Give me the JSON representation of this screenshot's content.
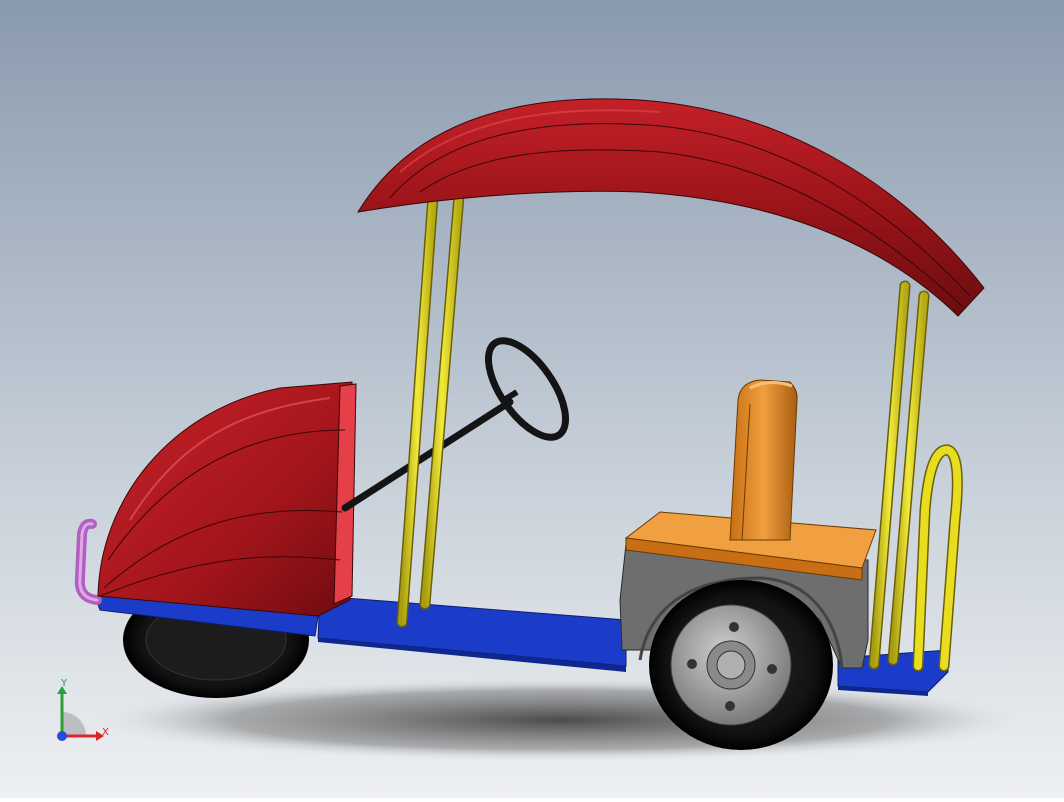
{
  "scene": {
    "background_top": "#8a9aae",
    "background_bottom": "#eef0f2",
    "colors": {
      "canopy": "#a8161b",
      "hood": "#b3161c",
      "poles": "#e8dd1e",
      "chassis": "#1a3cc8",
      "seat": "#e88f25",
      "body_gray": "#6e6e6e",
      "tire": "#121212",
      "hub": "#9a9a9a",
      "steering": "#141414",
      "bumper": "#c77ad0"
    },
    "objects": [
      "canopy-roof",
      "front-hood",
      "steering-wheel",
      "roof-poles",
      "seat",
      "rear-wheel",
      "front-wheel",
      "chassis",
      "rear-bumper-rail",
      "front-bumper-pipe"
    ]
  },
  "triad": {
    "x_label": "X",
    "y_label": "Y",
    "x_color": "#d8262a",
    "y_color": "#2aa03a",
    "z_color": "#2a4ad8"
  }
}
